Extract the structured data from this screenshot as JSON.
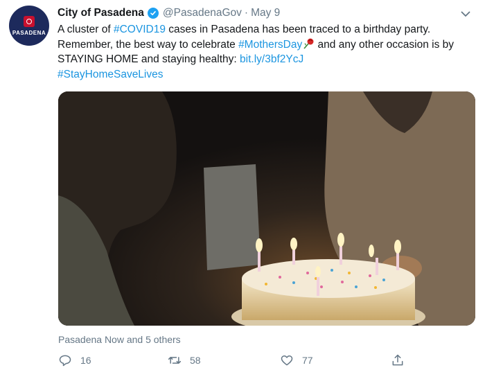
{
  "tweet": {
    "avatar_text": "PASADENA",
    "display_name": "City of Pasadena",
    "handle": "@PasadenaGov",
    "separator": "·",
    "date": "May 9",
    "text": {
      "p1": "A cluster of ",
      "tag_covid": "#COVID19",
      "p2": " cases in Pasadena has been traced to a birthday party. Remember, the best way to celebrate ",
      "tag_mothers": "#MothersDay",
      "p3": " and any other occasion is by STAYING HOME and staying healthy: ",
      "link": "bit.ly/3bf2YcJ",
      "tag_stayhome": "#StayHomeSaveLives"
    },
    "context": "Pasadena Now and 5 others",
    "actions": {
      "replies": "16",
      "retweets": "58",
      "likes": "77"
    }
  },
  "colors": {
    "link": "#1b95e0",
    "muted": "#657786",
    "verified": "#1da1f2"
  },
  "icons": [
    "verified-badge-icon",
    "chevron-down-icon",
    "rose-emoji-icon",
    "reply-icon",
    "retweet-icon",
    "like-icon",
    "share-icon"
  ]
}
